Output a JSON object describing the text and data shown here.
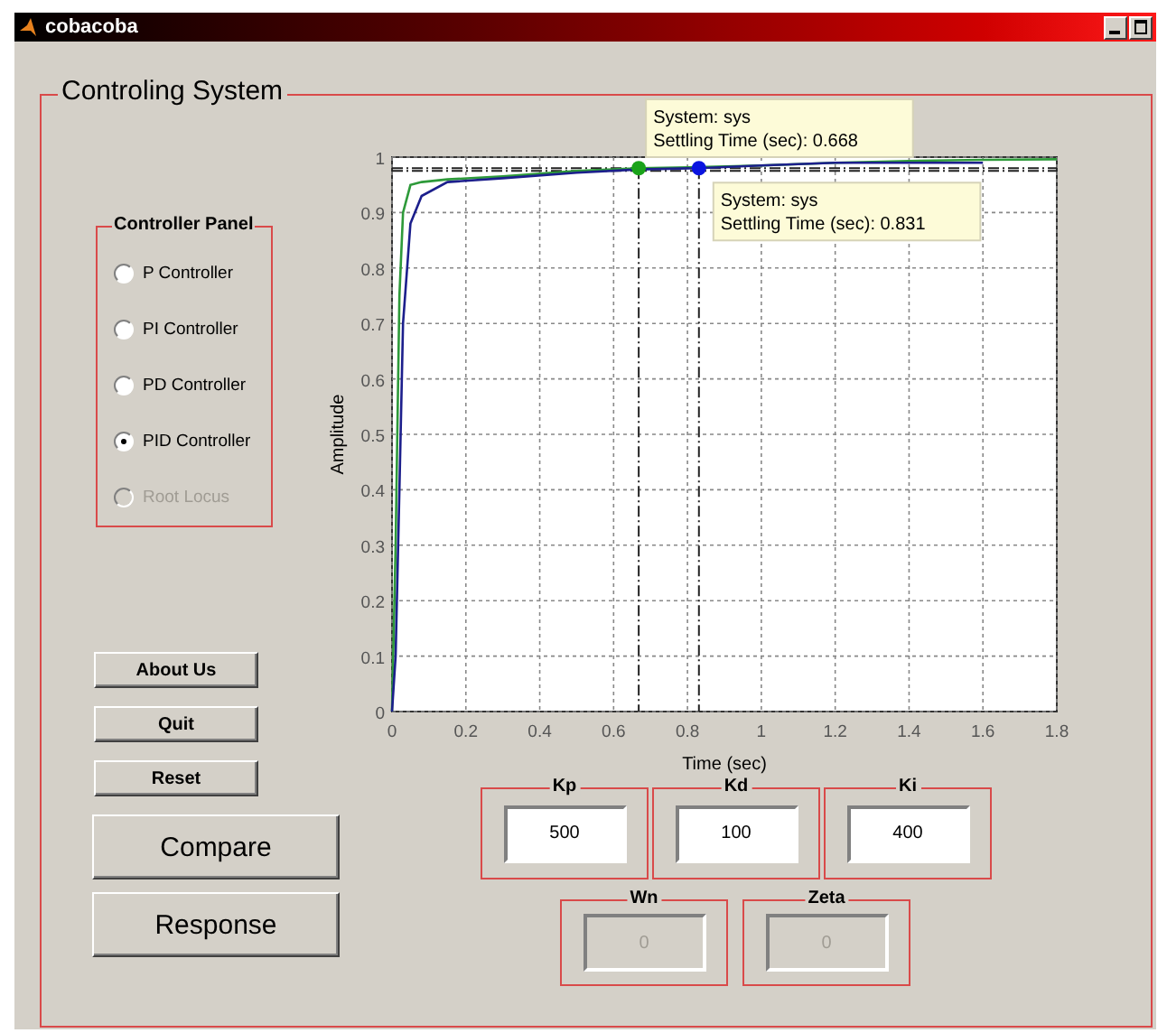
{
  "window": {
    "title": "cobacoba"
  },
  "panel": {
    "title": "Controling System"
  },
  "controller_panel": {
    "title": "Controller Panel",
    "options": [
      {
        "label": "P Controller",
        "selected": false,
        "disabled": false
      },
      {
        "label": "PI Controller",
        "selected": false,
        "disabled": false
      },
      {
        "label": "PD Controller",
        "selected": false,
        "disabled": false
      },
      {
        "label": "PID Controller",
        "selected": true,
        "disabled": false
      },
      {
        "label": "Root Locus",
        "selected": false,
        "disabled": true
      }
    ]
  },
  "buttons": [
    {
      "label": "About Us",
      "kind": "small"
    },
    {
      "label": "Quit",
      "kind": "small"
    },
    {
      "label": "Reset",
      "kind": "small"
    },
    {
      "label": "Compare",
      "kind": "large"
    },
    {
      "label": "Response",
      "kind": "large"
    }
  ],
  "chart": {
    "chart_data": {
      "type": "line",
      "xlabel": "Time (sec)",
      "ylabel": "Amplitude",
      "x": [
        0,
        0.01,
        0.02,
        0.03,
        0.05,
        0.08,
        0.15,
        0.3,
        0.5,
        0.668,
        0.831,
        1.0,
        1.2,
        1.4,
        1.6,
        1.8
      ],
      "series": [
        {
          "color": "#2e9a3a",
          "values": [
            0,
            0.3,
            0.75,
            0.9,
            0.95,
            0.955,
            0.96,
            0.965,
            0.975,
            0.98,
            0.982,
            0.985,
            0.99,
            0.993,
            0.995,
            0.996
          ]
        },
        {
          "color": "#1c1f8c",
          "values": [
            0,
            0.1,
            0.4,
            0.7,
            0.88,
            0.93,
            0.955,
            0.962,
            0.972,
            0.978,
            0.98,
            0.985,
            0.99,
            0.99,
            0.99,
            null
          ]
        }
      ],
      "xlim": [
        0,
        1.8
      ],
      "ylim": [
        0,
        1
      ],
      "xticks": [
        0,
        0.2,
        0.4,
        0.6,
        0.8,
        1,
        1.2,
        1.4,
        1.6,
        1.8
      ],
      "yticks": [
        0,
        0.1,
        0.2,
        0.3,
        0.4,
        0.5,
        0.6,
        0.7,
        0.8,
        0.9,
        1
      ],
      "grid": true
    },
    "datatips": [
      {
        "kind": "above",
        "lines": [
          "System: sys",
          "Settling Time (sec): 0.668"
        ]
      },
      {
        "kind": "below",
        "lines": [
          "System: sys",
          "Settling Time (sec): 0.831"
        ]
      }
    ]
  },
  "parameter_rows": [
    {
      "fields": [
        {
          "label": "Kp",
          "value": "500",
          "disabled": false
        },
        {
          "label": "Kd",
          "value": "100",
          "disabled": false
        },
        {
          "label": "Ki",
          "value": "400",
          "disabled": false
        }
      ]
    },
    {
      "fields": [
        {
          "label": "Wn",
          "value": "0",
          "disabled": true
        },
        {
          "label": "Zeta",
          "value": "0",
          "disabled": true
        }
      ]
    }
  ]
}
